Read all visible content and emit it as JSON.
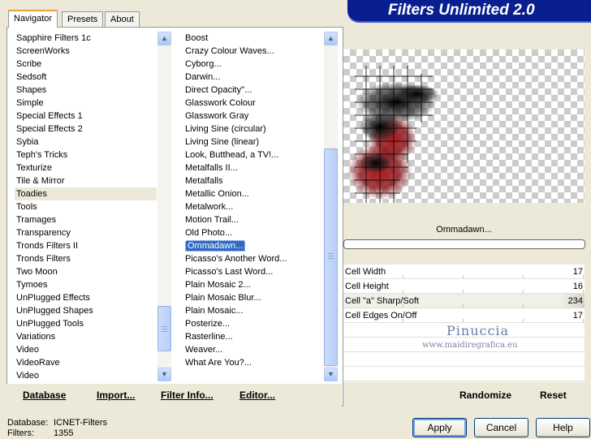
{
  "tabs": [
    {
      "label": "Navigator",
      "active": true
    },
    {
      "label": "Presets",
      "active": false
    },
    {
      "label": "About",
      "active": false
    }
  ],
  "app_title": "Filters Unlimited 2.0",
  "categories": {
    "items": [
      "Sapphire Filters 1c",
      "ScreenWorks",
      "Scribe",
      "Sedsoft",
      "Shapes",
      "Simple",
      "Special Effects 1",
      "Special Effects 2",
      "Sybia",
      "Teph's Tricks",
      "Texturize",
      "Tile & Mirror",
      "Toadies",
      "Tools",
      "Tramages",
      "Transparency",
      "Tronds Filters II",
      "Tronds Filters",
      "Two Moon",
      "Tymoes",
      "UnPlugged Effects",
      "UnPlugged Shapes",
      "UnPlugged Tools",
      "Variations",
      "Video",
      "VideoRave",
      "Video"
    ],
    "selected": "Toadies"
  },
  "filters": {
    "items": [
      "Boost",
      "Crazy Colour Waves...",
      "Cyborg...",
      "Darwin...",
      "Direct Opacity''...",
      "Glasswork Colour",
      "Glasswork Gray",
      "Living Sine (circular)",
      "Living Sine (linear)",
      "Look, Butthead, a TV!...",
      "Metalfalls II...",
      "Metalfalls",
      "Metallic Onion...",
      "Metalwork...",
      "Motion Trail...",
      "Old Photo...",
      "Ommadawn...",
      "Picasso's Another Word...",
      "Picasso's Last Word...",
      "Plain Mosaic 2...",
      "Plain Mosaic Blur...",
      "Plain Mosaic...",
      "Posterize...",
      "Rasterline...",
      "Weaver...",
      "What Are You?..."
    ],
    "selected": "Ommadawn..."
  },
  "current_filter": "Ommadawn...",
  "params": [
    {
      "label": "Cell Width",
      "value": "17",
      "fill": 0.07
    },
    {
      "label": "Cell Height",
      "value": "16",
      "fill": 0.06
    },
    {
      "label": "Cell \"a\" Sharp/Soft",
      "value": "234",
      "fill": 0.92
    },
    {
      "label": "Cell Edges On/Off",
      "value": "17",
      "fill": 0.07
    }
  ],
  "watermark": {
    "name": "Pinuccia",
    "site": "www.maidiregrafica.eu"
  },
  "toolbar": {
    "database": "Database",
    "import": "Import...",
    "filter_info": "Filter Info...",
    "editor": "Editor...",
    "randomize": "Randomize",
    "reset": "Reset"
  },
  "status": {
    "database_label": "Database:",
    "database_value": "ICNET-Filters",
    "filters_label": "Filters:",
    "filters_value": "1355"
  },
  "buttons": {
    "apply": "Apply",
    "cancel": "Cancel",
    "help": "Help"
  },
  "colors": {
    "banner": "#0a1f8f",
    "selection": "#316ac5",
    "accent_red": "#b01a20"
  }
}
